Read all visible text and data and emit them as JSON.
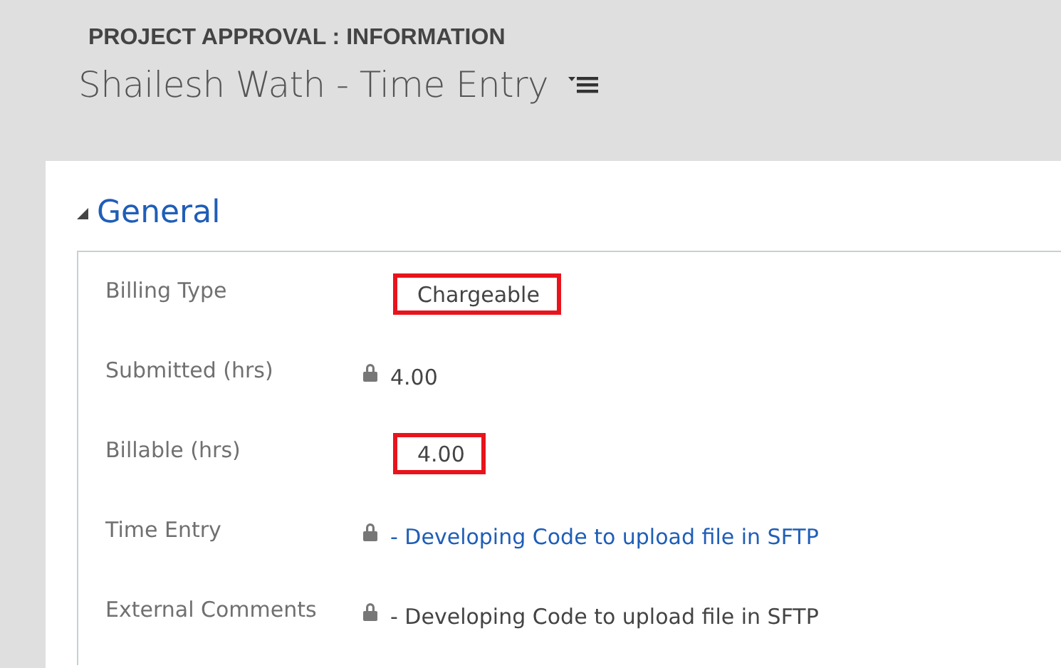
{
  "header": {
    "entity": "PROJECT APPROVAL : INFORMATION",
    "title": "Shailesh Wath - Time Entry"
  },
  "section": {
    "title": "General",
    "expanded": true,
    "fields": [
      {
        "label": "Billing Type",
        "value": "Chargeable",
        "kind": "text",
        "locked": false,
        "highlighted": true
      },
      {
        "label": "Submitted (hrs)",
        "value": "4.00",
        "kind": "text",
        "locked": true,
        "highlighted": false
      },
      {
        "label": "Billable (hrs)",
        "value": "4.00",
        "kind": "text",
        "locked": false,
        "highlighted": true
      },
      {
        "label": "Time Entry",
        "value": "- Developing Code to upload file in SFTP",
        "kind": "link",
        "locked": true,
        "highlighted": false
      },
      {
        "label": "External Comments",
        "value": "- Developing Code to upload file in SFTP",
        "kind": "text",
        "locked": true,
        "highlighted": false
      }
    ]
  }
}
